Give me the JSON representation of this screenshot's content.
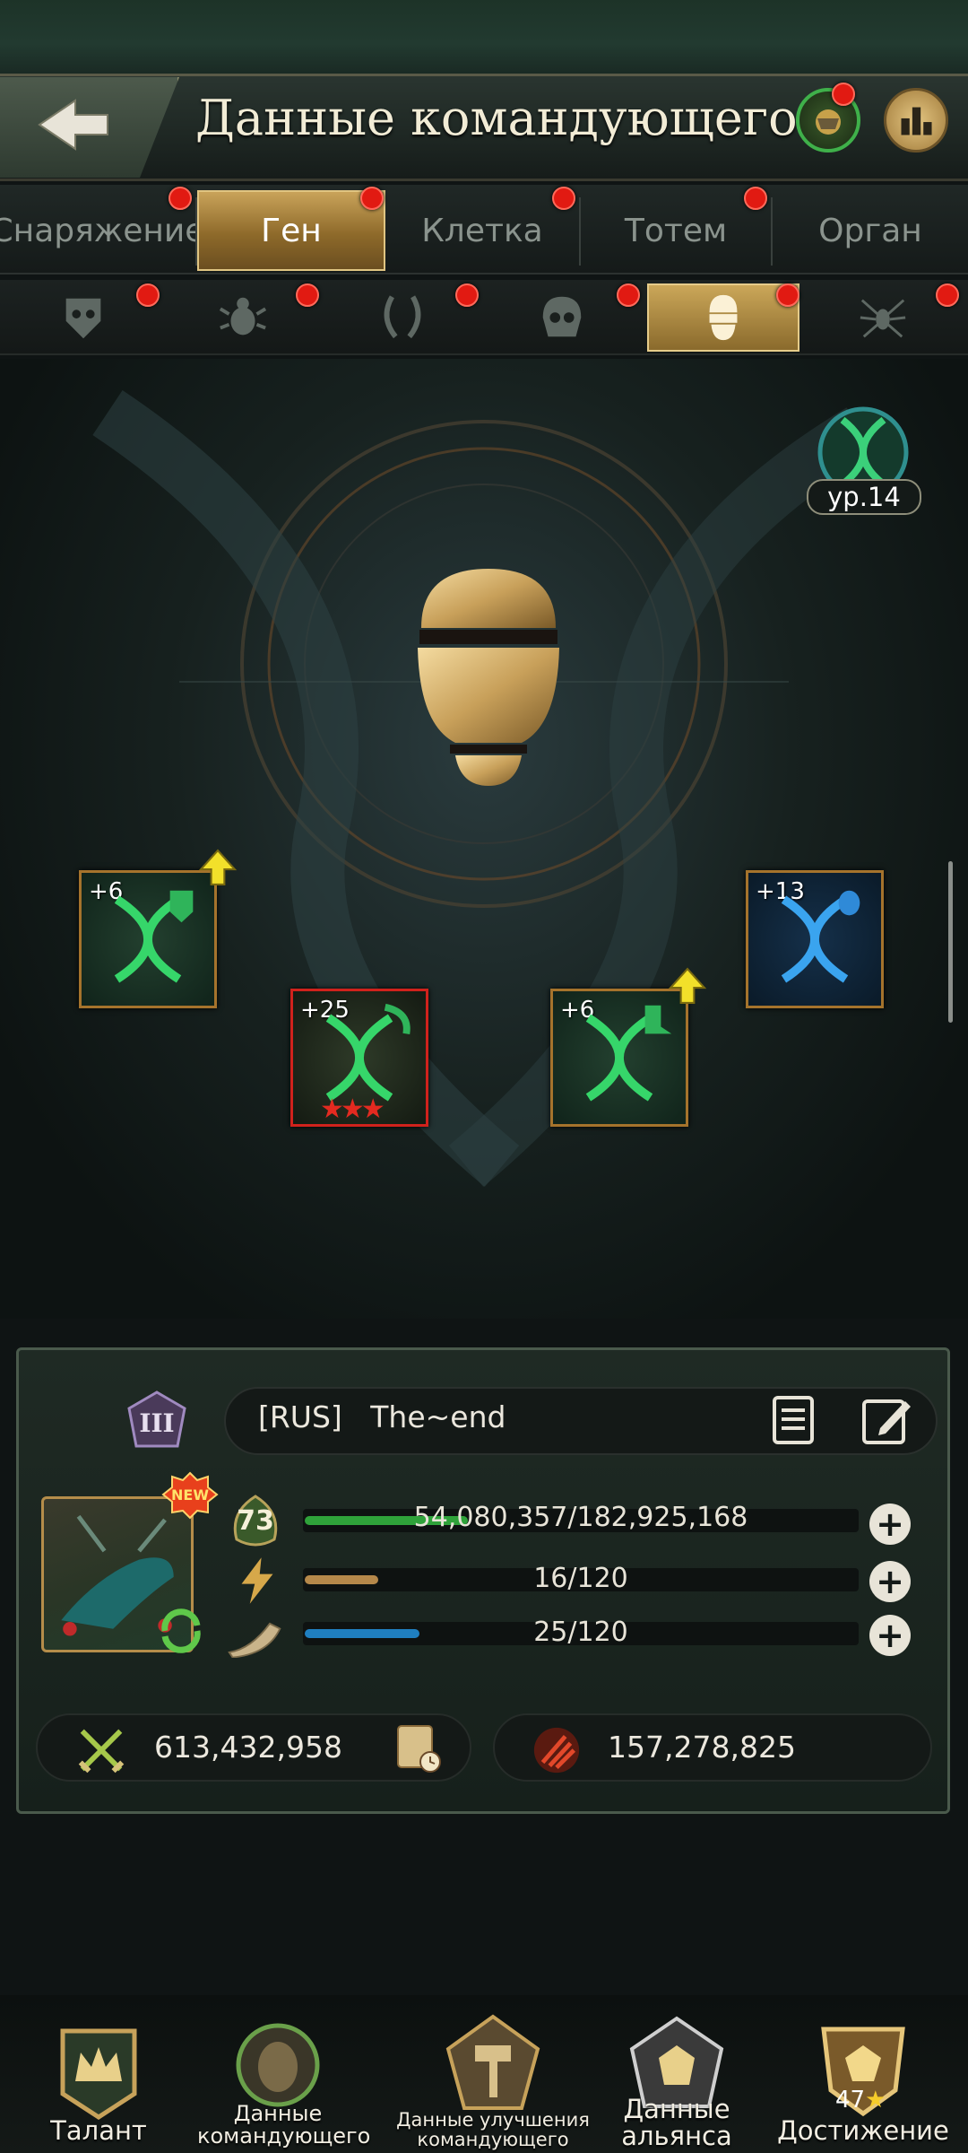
{
  "header": {
    "title": "Данные командующего"
  },
  "tabs": [
    {
      "label": "Снаряжение",
      "active": false
    },
    {
      "label": "Ген",
      "active": true
    },
    {
      "label": "Клетка",
      "active": false
    },
    {
      "label": "Тотем",
      "active": false
    },
    {
      "label": "Орган",
      "active": false
    }
  ],
  "subtabs": [
    {
      "icon": "shield-mask-icon",
      "active": false
    },
    {
      "icon": "beetle-icon",
      "active": false
    },
    {
      "icon": "mandible-icon",
      "active": false
    },
    {
      "icon": "skull-icon",
      "active": false
    },
    {
      "icon": "egg-icon",
      "active": true
    },
    {
      "icon": "spider-icon",
      "active": false
    }
  ],
  "gene": {
    "level_label": "ур.14",
    "slots": [
      {
        "plus": "+6",
        "stars": 0,
        "upgrade": true,
        "color": "green"
      },
      {
        "plus": "+25",
        "stars": 3,
        "upgrade": false,
        "color": "green"
      },
      {
        "plus": "+6",
        "stars": 0,
        "upgrade": true,
        "color": "green"
      },
      {
        "plus": "+13",
        "stars": 0,
        "upgrade": false,
        "color": "blue"
      }
    ]
  },
  "commander": {
    "name": "[RUS]   The~end",
    "rank": "III",
    "new_badge": "NEW",
    "level": "73",
    "exp": "54,080,357/182,925,168",
    "exp_fraction": 0.296,
    "energy": "16/120",
    "energy_fraction": 0.133,
    "stamina": "25/120",
    "stamina_fraction": 0.208,
    "power": "613,432,958",
    "kills": "157,278,825"
  },
  "colors": {
    "exp": "#2fa23a",
    "energy": "#b5884a",
    "stamina": "#1f7fc0",
    "notification": "#e11a12",
    "active_tab": "#c9a35a"
  },
  "bottom_nav": [
    {
      "label": "Талант",
      "icon": "crown-icon"
    },
    {
      "label": "Данные\nкомандующего",
      "icon": "commander-icon"
    },
    {
      "label": "Данные улучшения\nкомандующего",
      "icon": "hammer-icon"
    },
    {
      "label": "Данные\nальянса",
      "icon": "alliance-icon"
    },
    {
      "label": "Достижение",
      "icon": "achievement-icon",
      "count": "47"
    }
  ]
}
